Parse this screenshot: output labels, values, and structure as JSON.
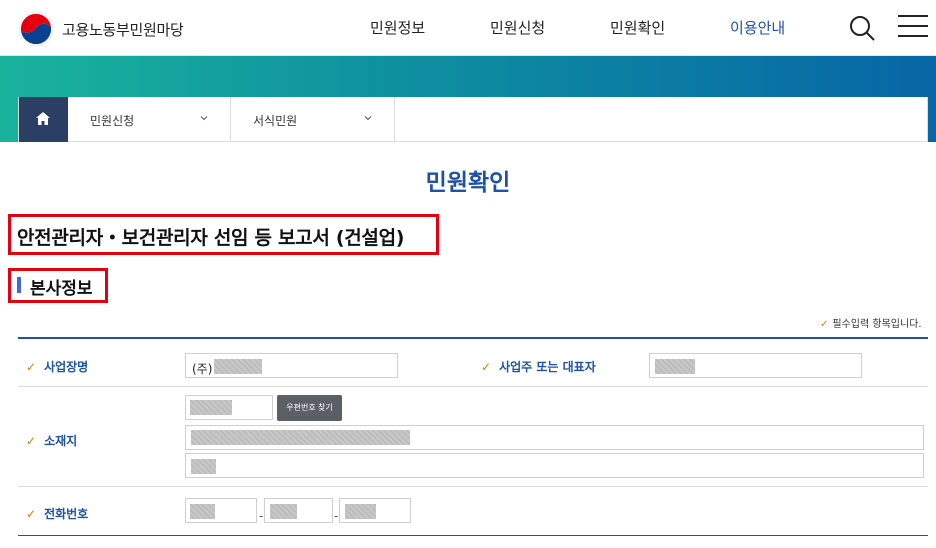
{
  "header": {
    "site_title": "고용노동부민원마당",
    "nav": [
      "민원정보",
      "민원신청",
      "민원확인",
      "이용안내"
    ]
  },
  "locbar": {
    "level1": "민원신청",
    "level2": "서식민원"
  },
  "page_title": "민원확인",
  "doc_title": "안전관리자・보건관리자 선임 등 보고서 (건설업)",
  "section_title": "본사정보",
  "required_note": "필수입력 항목입니다.",
  "form": {
    "business_name_label": "사업장명",
    "business_name_prefix": "(주)",
    "owner_label": "사업주 또는 대표자",
    "address_label": "소재지",
    "zip_button": "우편번호 찾기",
    "phone_label": "전화번호",
    "phone_sep": "-"
  },
  "colors": {
    "brand_blue": "#1d52a7",
    "highlight_red": "#e6000f",
    "check_orange": "#e07a00"
  }
}
